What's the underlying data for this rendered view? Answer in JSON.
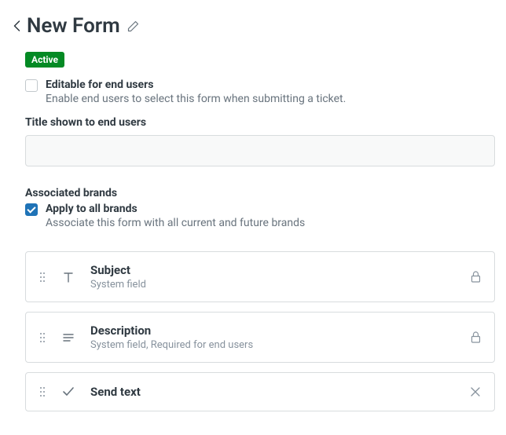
{
  "header": {
    "title": "New Form"
  },
  "status": {
    "label": "Active"
  },
  "editable": {
    "label": "Editable for end users",
    "description": "Enable end users to select this form when submitting a ticket.",
    "checked": false
  },
  "title_section": {
    "label": "Title shown to end users",
    "value": ""
  },
  "brands": {
    "heading": "Associated brands",
    "apply_all_label": "Apply to all brands",
    "apply_all_desc": "Associate this form with all current and future brands",
    "apply_all_checked": true
  },
  "fields": [
    {
      "title": "Subject",
      "subtitle": "System field",
      "type": "text",
      "locked": true,
      "removable": false
    },
    {
      "title": "Description",
      "subtitle": "System field, Required for end users",
      "type": "multiline",
      "locked": true,
      "removable": false
    },
    {
      "title": "Send text",
      "subtitle": "",
      "type": "checkbox",
      "locked": false,
      "removable": true
    }
  ]
}
